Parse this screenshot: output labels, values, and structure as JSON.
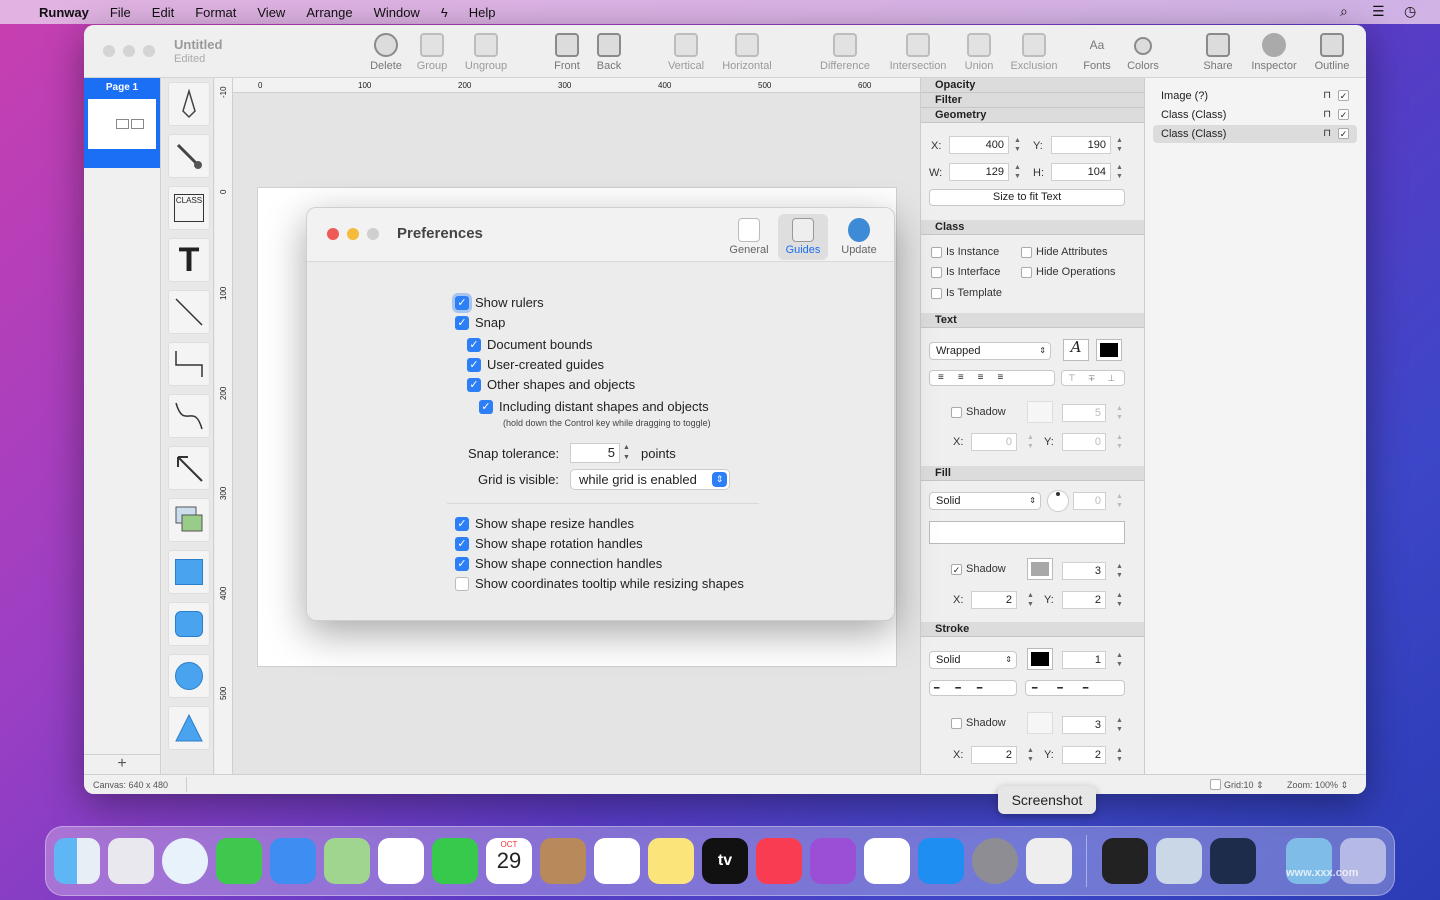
{
  "menubar": {
    "app": "Runway",
    "items": [
      "File",
      "Edit",
      "Format",
      "View",
      "Arrange",
      "Window",
      "Help"
    ]
  },
  "window": {
    "title": "Untitled",
    "subtitle": "Edited"
  },
  "toolbar": {
    "delete": "Delete",
    "group": "Group",
    "ungroup": "Ungroup",
    "front": "Front",
    "back": "Back",
    "vertical": "Vertical",
    "horizontal": "Horizontal",
    "difference": "Difference",
    "intersection": "Intersection",
    "union": "Union",
    "exclusion": "Exclusion",
    "fonts": "Fonts",
    "colors": "Colors",
    "share": "Share",
    "inspector": "Inspector",
    "outline": "Outline",
    "fonts_icon": "Aa"
  },
  "pages": {
    "page1": "Page 1",
    "add": "+"
  },
  "tools": {
    "class_label": "CLASS",
    "text_label": "T"
  },
  "ruler": {
    "h": [
      "0",
      "100",
      "200",
      "300",
      "400",
      "500",
      "600"
    ],
    "v": [
      "-10",
      "0",
      "100",
      "200",
      "300",
      "400",
      "500"
    ]
  },
  "status": {
    "canvas": "Canvas: 640 x 480",
    "grid": "Grid:10 ⇕",
    "zoom": "Zoom: 100% ⇕"
  },
  "inspector": {
    "opacity": "Opacity",
    "filter": "Filter",
    "geometry": "Geometry",
    "x_label": "X:",
    "x": "400",
    "y_label": "Y:",
    "y": "190",
    "w_label": "W:",
    "w": "129",
    "h_label": "H:",
    "h": "104",
    "size_fit": "Size to fit Text",
    "class_hdr": "Class",
    "is_instance": "Is Instance",
    "hide_attributes": "Hide Attributes",
    "is_interface": "Is Interface",
    "hide_operations": "Hide Operations",
    "is_template": "Is Template",
    "text_hdr": "Text",
    "wrapped": "Wrapped",
    "text_shadow": "Shadow",
    "text_shadow_size": "5",
    "text_sx": "0",
    "text_sy": "0",
    "font_icon": "A",
    "fill_hdr": "Fill",
    "fill_style": "Solid",
    "fill_angle": "0",
    "fill_shadow": "Shadow",
    "fill_shadow_size": "3",
    "fill_sx": "2",
    "fill_sy": "2",
    "stroke_hdr": "Stroke",
    "stroke_style": "Solid",
    "stroke_width": "1",
    "stroke_shadow": "Shadow",
    "stroke_shadow_size": "3",
    "stroke_sx": "2",
    "stroke_sy": "2",
    "x_lbl": "X:",
    "y_lbl": "Y:"
  },
  "objects": {
    "items": [
      "Image (?)",
      "Class (Class)",
      "Class (Class)"
    ]
  },
  "preferences": {
    "title": "Preferences",
    "tab_general": "General",
    "tab_guides": "Guides",
    "tab_update": "Update",
    "show_rulers": "Show rulers",
    "snap": "Snap",
    "document_bounds": "Document bounds",
    "user_guides": "User-created guides",
    "other_shapes": "Other shapes and objects",
    "distant_shapes": "Including distant shapes and objects",
    "distant_hint": "(hold down the Control key while dragging to toggle)",
    "snap_tolerance_label": "Snap tolerance:",
    "snap_tolerance": "5",
    "points": "points",
    "grid_visible_label": "Grid is visible:",
    "grid_visible": "while grid is enabled",
    "resize_handles": "Show shape resize handles",
    "rotation_handles": "Show shape rotation handles",
    "connection_handles": "Show shape connection handles",
    "coords_tooltip": "Show coordinates tooltip while resizing shapes"
  },
  "dock": {
    "tooltip": "Screenshot",
    "calendar_month": "OCT",
    "calendar_day": "29",
    "tv": "tv",
    "watermark": "www.xxx.com"
  },
  "colors": {
    "accent": "#1b6ff5",
    "checkbox": "#2c7ff7"
  }
}
